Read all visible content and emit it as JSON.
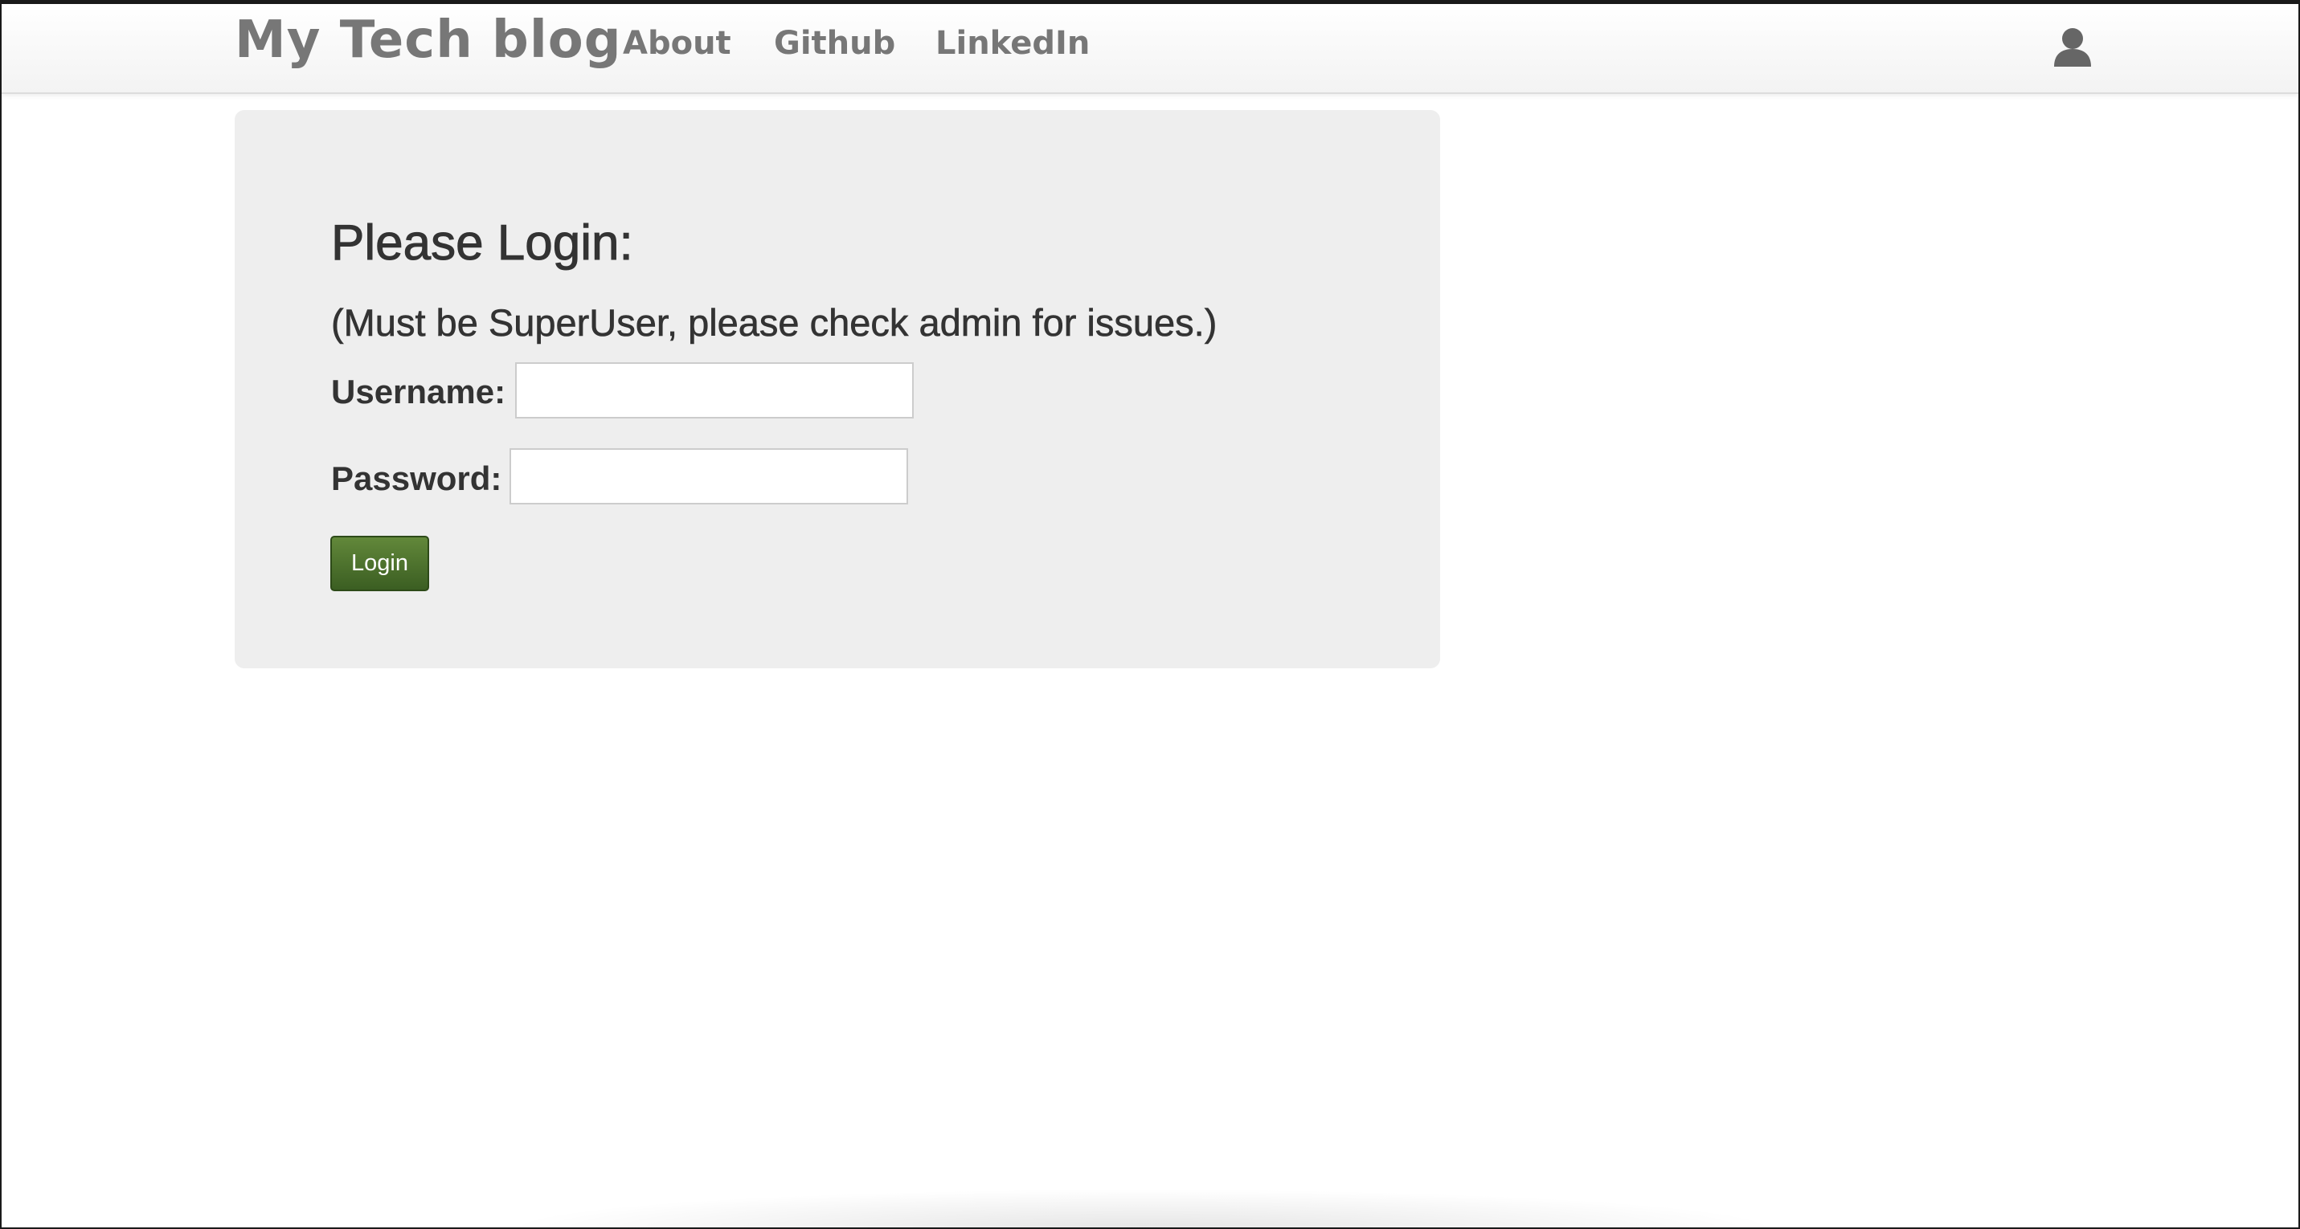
{
  "navbar": {
    "brand": "My Tech blog",
    "links": [
      {
        "label": "About"
      },
      {
        "label": "Github"
      },
      {
        "label": "LinkedIn"
      }
    ],
    "user_icon": "user-icon"
  },
  "login": {
    "heading": "Please Login:",
    "note": "(Must be SuperUser, please check admin for issues.)",
    "username_label": "Username:",
    "username_value": "",
    "password_label": "Password:",
    "password_value": "",
    "button_label": "Login"
  },
  "colors": {
    "nav_text": "#777777",
    "panel_bg": "#eeeeee",
    "button_bg": "#4a7029",
    "body_text": "#333333"
  }
}
